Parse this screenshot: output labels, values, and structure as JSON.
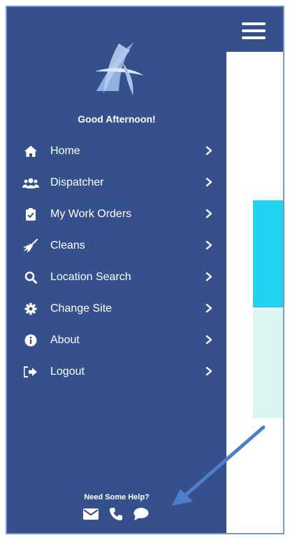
{
  "drawer": {
    "greeting": "Good Afternoon!",
    "items": [
      {
        "label": "Home",
        "icon": "home-icon"
      },
      {
        "label": "Dispatcher",
        "icon": "users-icon"
      },
      {
        "label": "My Work Orders",
        "icon": "clipboard-check-icon"
      },
      {
        "label": "Cleans",
        "icon": "broom-icon"
      },
      {
        "label": "Location Search",
        "icon": "search-icon"
      },
      {
        "label": "Change Site",
        "icon": "gear-icon"
      },
      {
        "label": "About",
        "icon": "info-icon"
      },
      {
        "label": "Logout",
        "icon": "sign-out-icon"
      }
    ],
    "help": {
      "title": "Need Some Help?",
      "icons": [
        "envelope-icon",
        "phone-icon",
        "chat-icon"
      ]
    }
  },
  "header": {
    "menu_icon": "hamburger-icon"
  },
  "colors": {
    "drawer_bg": "#35508a",
    "accent_cyan": "#1fd3f0",
    "mint": "#dcf4f1",
    "annotation_arrow": "#4a7fd0"
  }
}
